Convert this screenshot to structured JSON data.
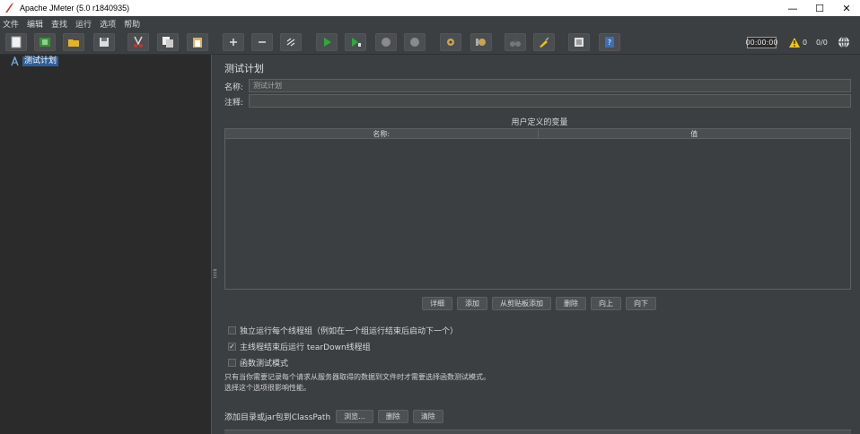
{
  "window": {
    "title": "Apache JMeter (5.0 r1840935)",
    "minimize": "—",
    "maximize": "☐",
    "close": "✕"
  },
  "menu": [
    "文件",
    "编辑",
    "查找",
    "运行",
    "选项",
    "帮助"
  ],
  "toolbar": {
    "buttons": [
      "new",
      "templates",
      "open",
      "save",
      "cut",
      "copy",
      "paste",
      "expand",
      "collapse",
      "toggle",
      "start",
      "start-no-pauses",
      "stop",
      "shutdown",
      "clear",
      "clear-all",
      "search",
      "reset-search",
      "function-helper",
      "help"
    ],
    "timer": "00:00:00",
    "warnings": "0",
    "threads": "0/0"
  },
  "tree": {
    "root_label": "测试计划"
  },
  "panel": {
    "title": "测试计划",
    "name_label": "名称:",
    "name_value": "测试计划",
    "comment_label": "注释:",
    "comment_value": "",
    "vars_title": "用户定义的变量",
    "col_name": "名称:",
    "col_value": "值",
    "buttons": {
      "detail": "详细",
      "add": "添加",
      "add_clipboard": "从剪贴板添加",
      "delete": "删除",
      "up": "向上",
      "down": "向下"
    },
    "checkboxes": [
      {
        "label": "独立运行每个线程组（例如在一个组运行结束后启动下一个）",
        "checked": false
      },
      {
        "label": "主线程结束后运行 tearDown线程组",
        "checked": true
      },
      {
        "label": "函数测试模式",
        "checked": false
      }
    ],
    "note_line1": "只有当你需要记录每个请求从服务器取得的数据到文件时才需要选择函数测试模式。",
    "note_line2": "选择这个选项很影响性能。",
    "classpath_label": "添加目录或jar包到ClassPath",
    "classpath_buttons": {
      "browse": "浏览...",
      "delete": "删除",
      "clear": "清除"
    }
  },
  "colors": {
    "bg": "#3c3f41",
    "tree_bg": "#2b2b2b",
    "selection": "#2d5f99"
  }
}
